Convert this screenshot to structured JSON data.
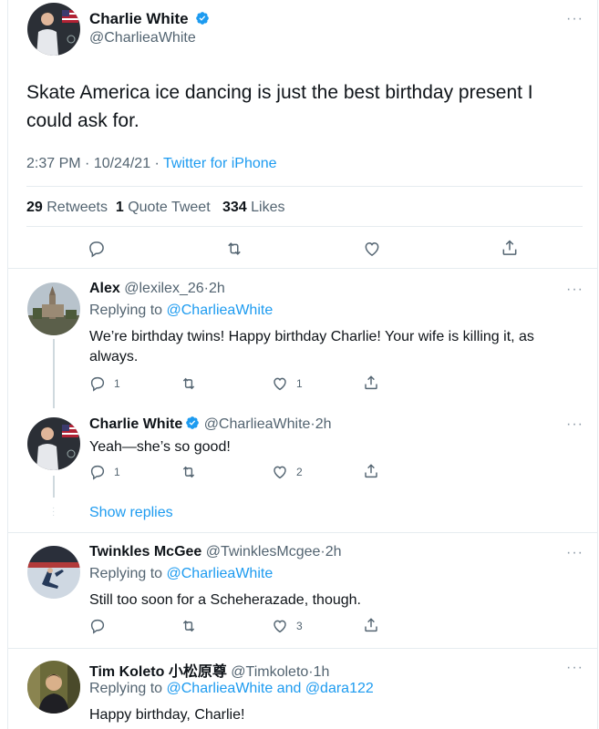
{
  "main_tweet": {
    "name": "Charlie White",
    "handle": "@CharlieaWhite",
    "text": "Skate America ice dancing is just the best birthday present I could ask for.",
    "time": "2:37 PM",
    "date": "10/24/21",
    "source": "Twitter for iPhone",
    "retweets_count": "29",
    "retweets_label": "Retweets",
    "quotes_count": "1",
    "quotes_label": "Quote Tweet",
    "likes_count": "334",
    "likes_label": "Likes"
  },
  "replies": [
    {
      "name": "Alex",
      "handle": "@lexilex_26",
      "age": "2h",
      "replying_label": "Replying to",
      "replying_to": "@CharlieaWhite",
      "text": "We’re birthday twins! Happy birthday Charlie! Your wife is killing it, as always.",
      "reply_count": "1",
      "retweet_count": "",
      "like_count": "1"
    },
    {
      "name": "Charlie White",
      "handle": "@CharlieaWhite",
      "age": "2h",
      "text": "Yeah—she’s so good!",
      "reply_count": "1",
      "retweet_count": "",
      "like_count": "2",
      "show_replies": "Show replies"
    },
    {
      "name": "Twinkles McGee",
      "handle": "@TwinklesMcgee",
      "age": "2h",
      "replying_label": "Replying to",
      "replying_to": "@CharlieaWhite",
      "text": "Still too soon for a Scheherazade, though.",
      "reply_count": "",
      "retweet_count": "",
      "like_count": "3"
    },
    {
      "name": "Tim Koleto 小松原尊",
      "handle": "@Timkoleto",
      "age": "1h",
      "replying_label": "Replying to",
      "replying_to": "@CharlieaWhite and @dara122",
      "text": "Happy birthday, Charlie!"
    }
  ],
  "colors": {
    "accent": "#1d9bf0",
    "text_secondary": "#536471",
    "divider": "#e6ecf0"
  },
  "icons": [
    "verified-badge-icon",
    "more-icon",
    "reply-icon",
    "retweet-icon",
    "like-icon",
    "share-icon"
  ]
}
